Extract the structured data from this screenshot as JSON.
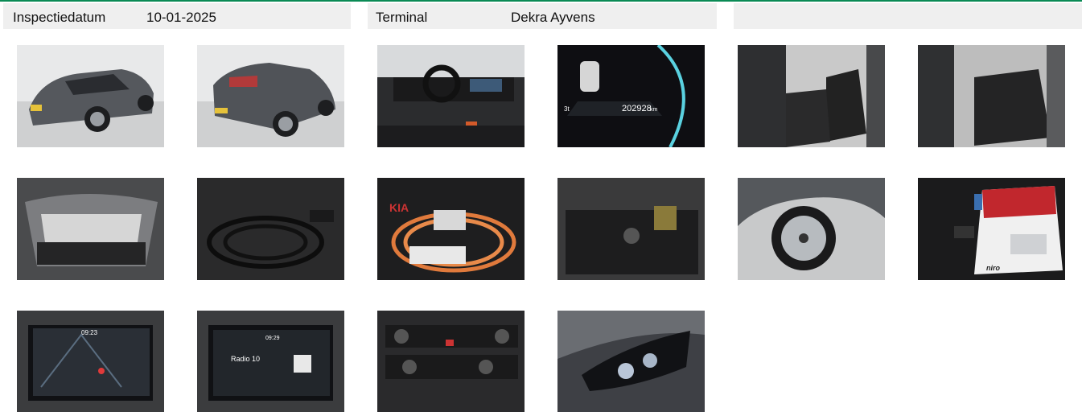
{
  "header": {
    "inspection_label": "Inspectiedatum",
    "inspection_date": "10-01-2025",
    "terminal_label": "Terminal",
    "terminal_value": "Dekra Ayvens"
  },
  "photos": [
    {
      "subject": "car front-left exterior",
      "icon": "car-front-photo"
    },
    {
      "subject": "car rear-left exterior",
      "icon": "car-rear-photo"
    },
    {
      "subject": "dashboard interior",
      "icon": "dashboard-photo"
    },
    {
      "subject": "instrument cluster",
      "icon": "odometer-photo",
      "odometer_text": "202928",
      "odometer_unit": "km",
      "range_text": "3t"
    },
    {
      "subject": "front seats",
      "icon": "front-seats-photo"
    },
    {
      "subject": "rear seats",
      "icon": "rear-seats-photo"
    },
    {
      "subject": "open trunk",
      "icon": "trunk-photo"
    },
    {
      "subject": "charging cable in trunk",
      "icon": "cable-photo"
    },
    {
      "subject": "orange charging cable",
      "icon": "orange-cable-photo",
      "brand_text": "KIA"
    },
    {
      "subject": "spare compartment",
      "icon": "compartment-photo"
    },
    {
      "subject": "wheel",
      "icon": "wheel-photo"
    },
    {
      "subject": "keys and manual",
      "icon": "keys-manual-photo",
      "manual_text": "niro"
    },
    {
      "subject": "navigation screen",
      "icon": "nav-screen-photo",
      "screen_time": "09:23"
    },
    {
      "subject": "radio screen",
      "icon": "radio-screen-photo",
      "screen_time": "09:29",
      "radio_text": "Radio 10"
    },
    {
      "subject": "climate controls",
      "icon": "climate-controls-photo"
    },
    {
      "subject": "headlight",
      "icon": "headlight-photo"
    }
  ]
}
